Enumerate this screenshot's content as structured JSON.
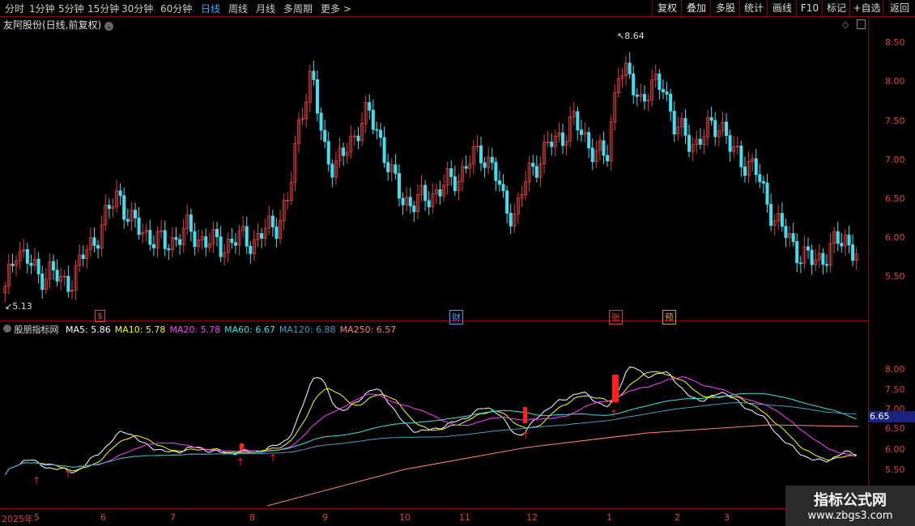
{
  "toolbar": {
    "tabs": [
      {
        "label": "分时"
      },
      {
        "label": "1分钟"
      },
      {
        "label": "5分钟"
      },
      {
        "label": "15分钟"
      },
      {
        "label": "30分钟"
      },
      {
        "label": "60分钟"
      },
      {
        "label": "日线",
        "active": true
      },
      {
        "label": "周线"
      },
      {
        "label": "月线"
      },
      {
        "label": "多周期"
      },
      {
        "label": "更多 >"
      }
    ],
    "buttons": [
      "复权",
      "叠加",
      "多股",
      "统计",
      "画线",
      "F10",
      "标记",
      "+自选",
      "返回"
    ]
  },
  "main_chart": {
    "title": "友阿股份(日线,前复权)",
    "high_label": "8.64",
    "low_label": "5.13",
    "y_ticks": [
      "8.50",
      "8.00",
      "7.50",
      "7.00",
      "6.50",
      "6.00",
      "5.50"
    ],
    "badges": [
      {
        "text": "$",
        "color": "#e04040"
      },
      {
        "text": "财",
        "color": "#3aa0ff"
      },
      {
        "text": "张",
        "color": "#e04040"
      },
      {
        "text": "预",
        "color": "#d0a020"
      }
    ]
  },
  "indicator": {
    "name": "股朋指标网",
    "items": [
      {
        "label": "MA5:",
        "value": "5.86",
        "color": "#ffffff"
      },
      {
        "label": "MA10:",
        "value": "5.78",
        "color": "#ffff00"
      },
      {
        "label": "MA20:",
        "value": "5.78",
        "color": "#ff40ff"
      },
      {
        "label": "MA60:",
        "value": "6.67",
        "color": "#40e0e0"
      },
      {
        "label": "MA120:",
        "value": "6.88",
        "color": "#40a0c0"
      },
      {
        "label": "MA250:",
        "value": "6.57",
        "color": "#ff8080"
      }
    ],
    "y_ticks": [
      "8.00",
      "7.50",
      "7.00",
      "6.50",
      "6.00",
      "5.50"
    ],
    "current_value": "6.65"
  },
  "x_axis": [
    "2025年",
    "5",
    "6",
    "7",
    "8",
    "9",
    "10",
    "11",
    "12",
    "1",
    "2",
    "3"
  ],
  "watermark": {
    "title": "指标公式网",
    "url": "www.zbgs3.com"
  },
  "chart_data": {
    "type": "candlestick",
    "series_approx_closes": [
      5.3,
      5.9,
      5.7,
      5.5,
      5.6,
      5.4,
      5.5,
      5.8,
      6.0,
      6.3,
      6.6,
      6.2,
      6.1,
      6.0,
      5.9,
      6.0,
      6.1,
      6.0,
      5.95,
      5.9,
      5.95,
      6.0,
      5.95,
      6.1,
      6.2,
      6.5,
      7.6,
      8.1,
      7.2,
      6.9,
      7.1,
      7.4,
      7.6,
      7.3,
      6.8,
      6.5,
      6.45,
      6.5,
      6.6,
      6.7,
      6.8,
      7.0,
      7.1,
      6.9,
      6.4,
      6.3,
      6.8,
      7.0,
      7.2,
      7.3,
      7.5,
      7.3,
      7.1,
      7.0,
      8.2,
      8.0,
      7.8,
      7.9,
      8.0,
      7.4,
      7.3,
      7.2,
      7.4,
      7.5,
      7.1,
      7.0,
      6.9,
      6.5,
      6.2,
      6.0,
      5.8,
      5.7,
      5.75,
      5.9,
      6.0,
      5.8
    ],
    "ylim": [
      5.0,
      8.9
    ]
  }
}
